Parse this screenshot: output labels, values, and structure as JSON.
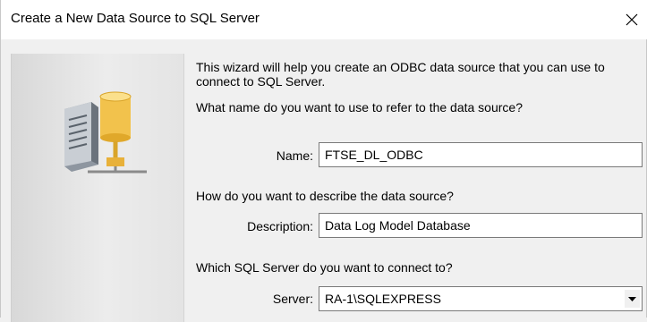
{
  "window": {
    "title": "Create a New Data Source to SQL Server"
  },
  "icons": {
    "close": "close-icon",
    "server": "database-server-icon",
    "dropdown": "chevron-down-icon"
  },
  "intro": {
    "line1": "This wizard will help you create an ODBC data source that you can use to",
    "line2": "connect to SQL Server."
  },
  "name_section": {
    "question": "What name do you want to use to refer to the data source?",
    "label": "Name:",
    "value": "FTSE_DL_ODBC"
  },
  "description_section": {
    "question": "How do you want to describe the data source?",
    "label": "Description:",
    "value": "Data Log Model Database"
  },
  "server_section": {
    "question": "Which SQL Server do you want to connect to?",
    "label": "Server:",
    "value": "RA-1\\SQLEXPRESS"
  }
}
